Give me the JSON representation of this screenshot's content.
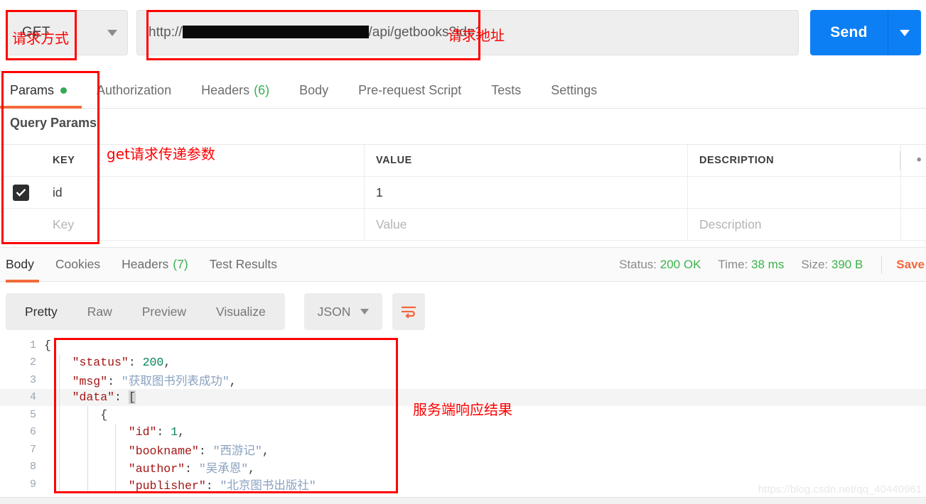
{
  "request": {
    "method": "GET",
    "method_caret_icon": "chevron-down-icon",
    "url_prefix": "http://",
    "url_suffix": "/api/getbooks?id=1",
    "url_redacted": true,
    "send_label": "Send",
    "send_caret_icon": "chevron-down-icon"
  },
  "request_tabs": [
    {
      "label": "Params",
      "badge": "",
      "dot": true,
      "active": true
    },
    {
      "label": "Authorization",
      "badge": "",
      "dot": false,
      "active": false
    },
    {
      "label": "Headers",
      "badge": "(6)",
      "dot": false,
      "active": false
    },
    {
      "label": "Body",
      "badge": "",
      "dot": false,
      "active": false
    },
    {
      "label": "Pre-request Script",
      "badge": "",
      "dot": false,
      "active": false
    },
    {
      "label": "Tests",
      "badge": "",
      "dot": false,
      "active": false
    },
    {
      "label": "Settings",
      "badge": "",
      "dot": false,
      "active": false
    }
  ],
  "query_params": {
    "title": "Query Params",
    "columns": [
      "KEY",
      "VALUE",
      "DESCRIPTION"
    ],
    "more_icon": "bulk-edit-dots-icon",
    "rows": [
      {
        "checked": true,
        "key": "id",
        "value": "1",
        "description": ""
      },
      {
        "checked": false,
        "key": "",
        "value": "",
        "description": "",
        "key_placeholder": "Key",
        "value_placeholder": "Value",
        "description_placeholder": "Description"
      }
    ]
  },
  "response_tabs": [
    {
      "label": "Body",
      "badge": "",
      "active": true
    },
    {
      "label": "Cookies",
      "badge": "",
      "active": false
    },
    {
      "label": "Headers",
      "badge": "(7)",
      "active": false
    },
    {
      "label": "Test Results",
      "badge": "",
      "active": false
    }
  ],
  "response_status": {
    "status_label": "Status:",
    "status_value": "200 OK",
    "time_label": "Time:",
    "time_value": "38 ms",
    "size_label": "Size:",
    "size_value": "390 B",
    "save_label": "Save",
    "success_color": "#3bb34a",
    "accent_color": "#f2663c"
  },
  "format_toolbar": {
    "views": [
      {
        "label": "Pretty",
        "active": true
      },
      {
        "label": "Raw",
        "active": false
      },
      {
        "label": "Preview",
        "active": false
      },
      {
        "label": "Visualize",
        "active": false
      }
    ],
    "language": "JSON",
    "language_caret_icon": "chevron-down-icon",
    "wrap_icon": "word-wrap-icon"
  },
  "response_body": {
    "lines": [
      {
        "n": "1",
        "tokens": [
          {
            "t": "{",
            "c": "pun"
          }
        ],
        "indent": 0,
        "guides": []
      },
      {
        "n": "2",
        "tokens": [
          {
            "t": "\"status\"",
            "c": "k"
          },
          {
            "t": ": ",
            "c": "pun"
          },
          {
            "t": "200",
            "c": "num"
          },
          {
            "t": ",",
            "c": "pun"
          }
        ],
        "indent": 1,
        "guides": [
          1
        ]
      },
      {
        "n": "3",
        "tokens": [
          {
            "t": "\"msg\"",
            "c": "k"
          },
          {
            "t": ": ",
            "c": "pun"
          },
          {
            "t": "\"获取图书列表成功\"",
            "c": "str"
          },
          {
            "t": ",",
            "c": "pun"
          }
        ],
        "indent": 1,
        "guides": [
          1
        ]
      },
      {
        "n": "4",
        "tokens": [
          {
            "t": "\"data\"",
            "c": "k"
          },
          {
            "t": ": ",
            "c": "pun"
          },
          {
            "t": "[",
            "c": "brhl"
          }
        ],
        "indent": 1,
        "guides": [
          1
        ],
        "highlight": true
      },
      {
        "n": "5",
        "tokens": [
          {
            "t": "{",
            "c": "pun"
          }
        ],
        "indent": 2,
        "guides": [
          1,
          2
        ]
      },
      {
        "n": "6",
        "tokens": [
          {
            "t": "\"id\"",
            "c": "k"
          },
          {
            "t": ": ",
            "c": "pun"
          },
          {
            "t": "1",
            "c": "num"
          },
          {
            "t": ",",
            "c": "pun"
          }
        ],
        "indent": 3,
        "guides": [
          1,
          2,
          3
        ]
      },
      {
        "n": "7",
        "tokens": [
          {
            "t": "\"bookname\"",
            "c": "k"
          },
          {
            "t": ": ",
            "c": "pun"
          },
          {
            "t": "\"西游记\"",
            "c": "str"
          },
          {
            "t": ",",
            "c": "pun"
          }
        ],
        "indent": 3,
        "guides": [
          1,
          2,
          3
        ]
      },
      {
        "n": "8",
        "tokens": [
          {
            "t": "\"author\"",
            "c": "k"
          },
          {
            "t": ": ",
            "c": "pun"
          },
          {
            "t": "\"吴承恩\"",
            "c": "str"
          },
          {
            "t": ",",
            "c": "pun"
          }
        ],
        "indent": 3,
        "guides": [
          1,
          2,
          3
        ]
      },
      {
        "n": "9",
        "tokens": [
          {
            "t": "\"publisher\"",
            "c": "k"
          },
          {
            "t": ": ",
            "c": "pun"
          },
          {
            "t": "\"北京图书出版社\"",
            "c": "str"
          }
        ],
        "indent": 3,
        "guides": [
          1,
          2,
          3
        ]
      }
    ]
  },
  "annotations": [
    {
      "id": "method",
      "text": "请求方式"
    },
    {
      "id": "url",
      "text": "请求地址"
    },
    {
      "id": "params",
      "text": "get请求传递参数"
    },
    {
      "id": "response",
      "text": "服务端响应结果"
    }
  ],
  "watermark": "https://blog.csdn.net/qq_40440961"
}
